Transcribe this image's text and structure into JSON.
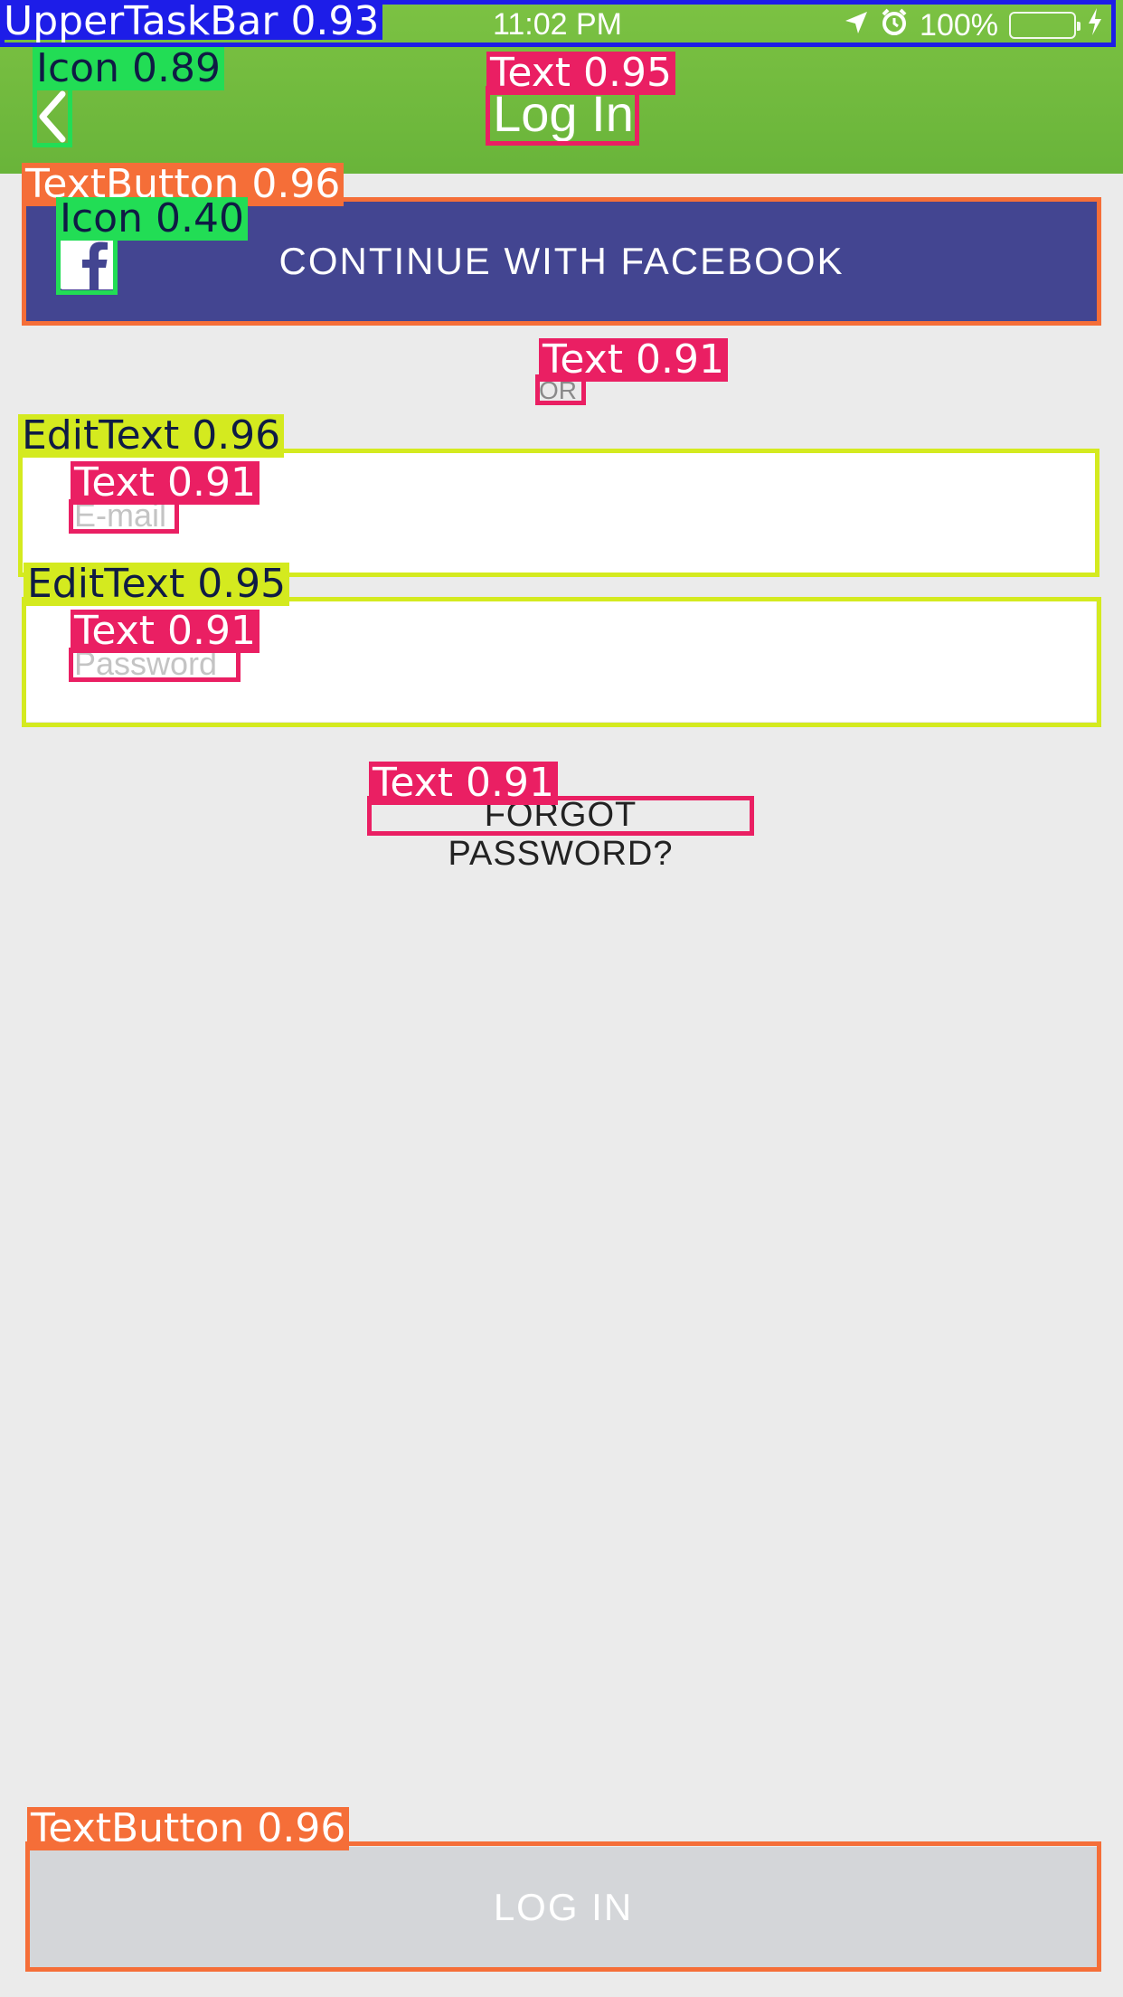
{
  "status_bar": {
    "time": "11:02 PM",
    "battery": "100%",
    "icons": [
      "location-arrow-icon",
      "alarm-icon",
      "battery-icon",
      "charging-bolt-icon"
    ]
  },
  "header": {
    "title": "Log In",
    "back_icon": "chevron-left-icon"
  },
  "facebook_button": {
    "label": "CONTINUE WITH FACEBOOK",
    "icon": "facebook-icon"
  },
  "divider": {
    "text": "OR"
  },
  "form": {
    "email": {
      "placeholder": "E-mail",
      "value": ""
    },
    "password": {
      "placeholder": "Password",
      "value": ""
    },
    "forgot_password": "FORGOT PASSWORD?"
  },
  "login_button": {
    "label": "LOG IN"
  },
  "detections": [
    {
      "label": "UpperTaskBar",
      "score": "0.93"
    },
    {
      "label": "Icon",
      "score": "0.89"
    },
    {
      "label": "Text",
      "score": "0.95"
    },
    {
      "label": "TextButton",
      "score": "0.96"
    },
    {
      "label": "Icon",
      "score": "0.40"
    },
    {
      "label": "Text",
      "score": "0.91"
    },
    {
      "label": "EditText",
      "score": "0.96"
    },
    {
      "label": "Text",
      "score": "0.91"
    },
    {
      "label": "EditText",
      "score": "0.95"
    },
    {
      "label": "Text",
      "score": "0.91"
    },
    {
      "label": "Text",
      "score": "0.91"
    },
    {
      "label": "TextButton",
      "score": "0.96"
    }
  ],
  "colors": {
    "header_green": "#72bb40",
    "facebook_blue": "#434591",
    "background": "#ebebeb",
    "login_disabled": "#d4d6d9",
    "det_upper_taskbar": "#1d1de8",
    "det_icon": "#22dd55",
    "det_text": "#ea1f63",
    "det_textbutton": "#f56e38",
    "det_edittext": "#d4ea1f"
  }
}
